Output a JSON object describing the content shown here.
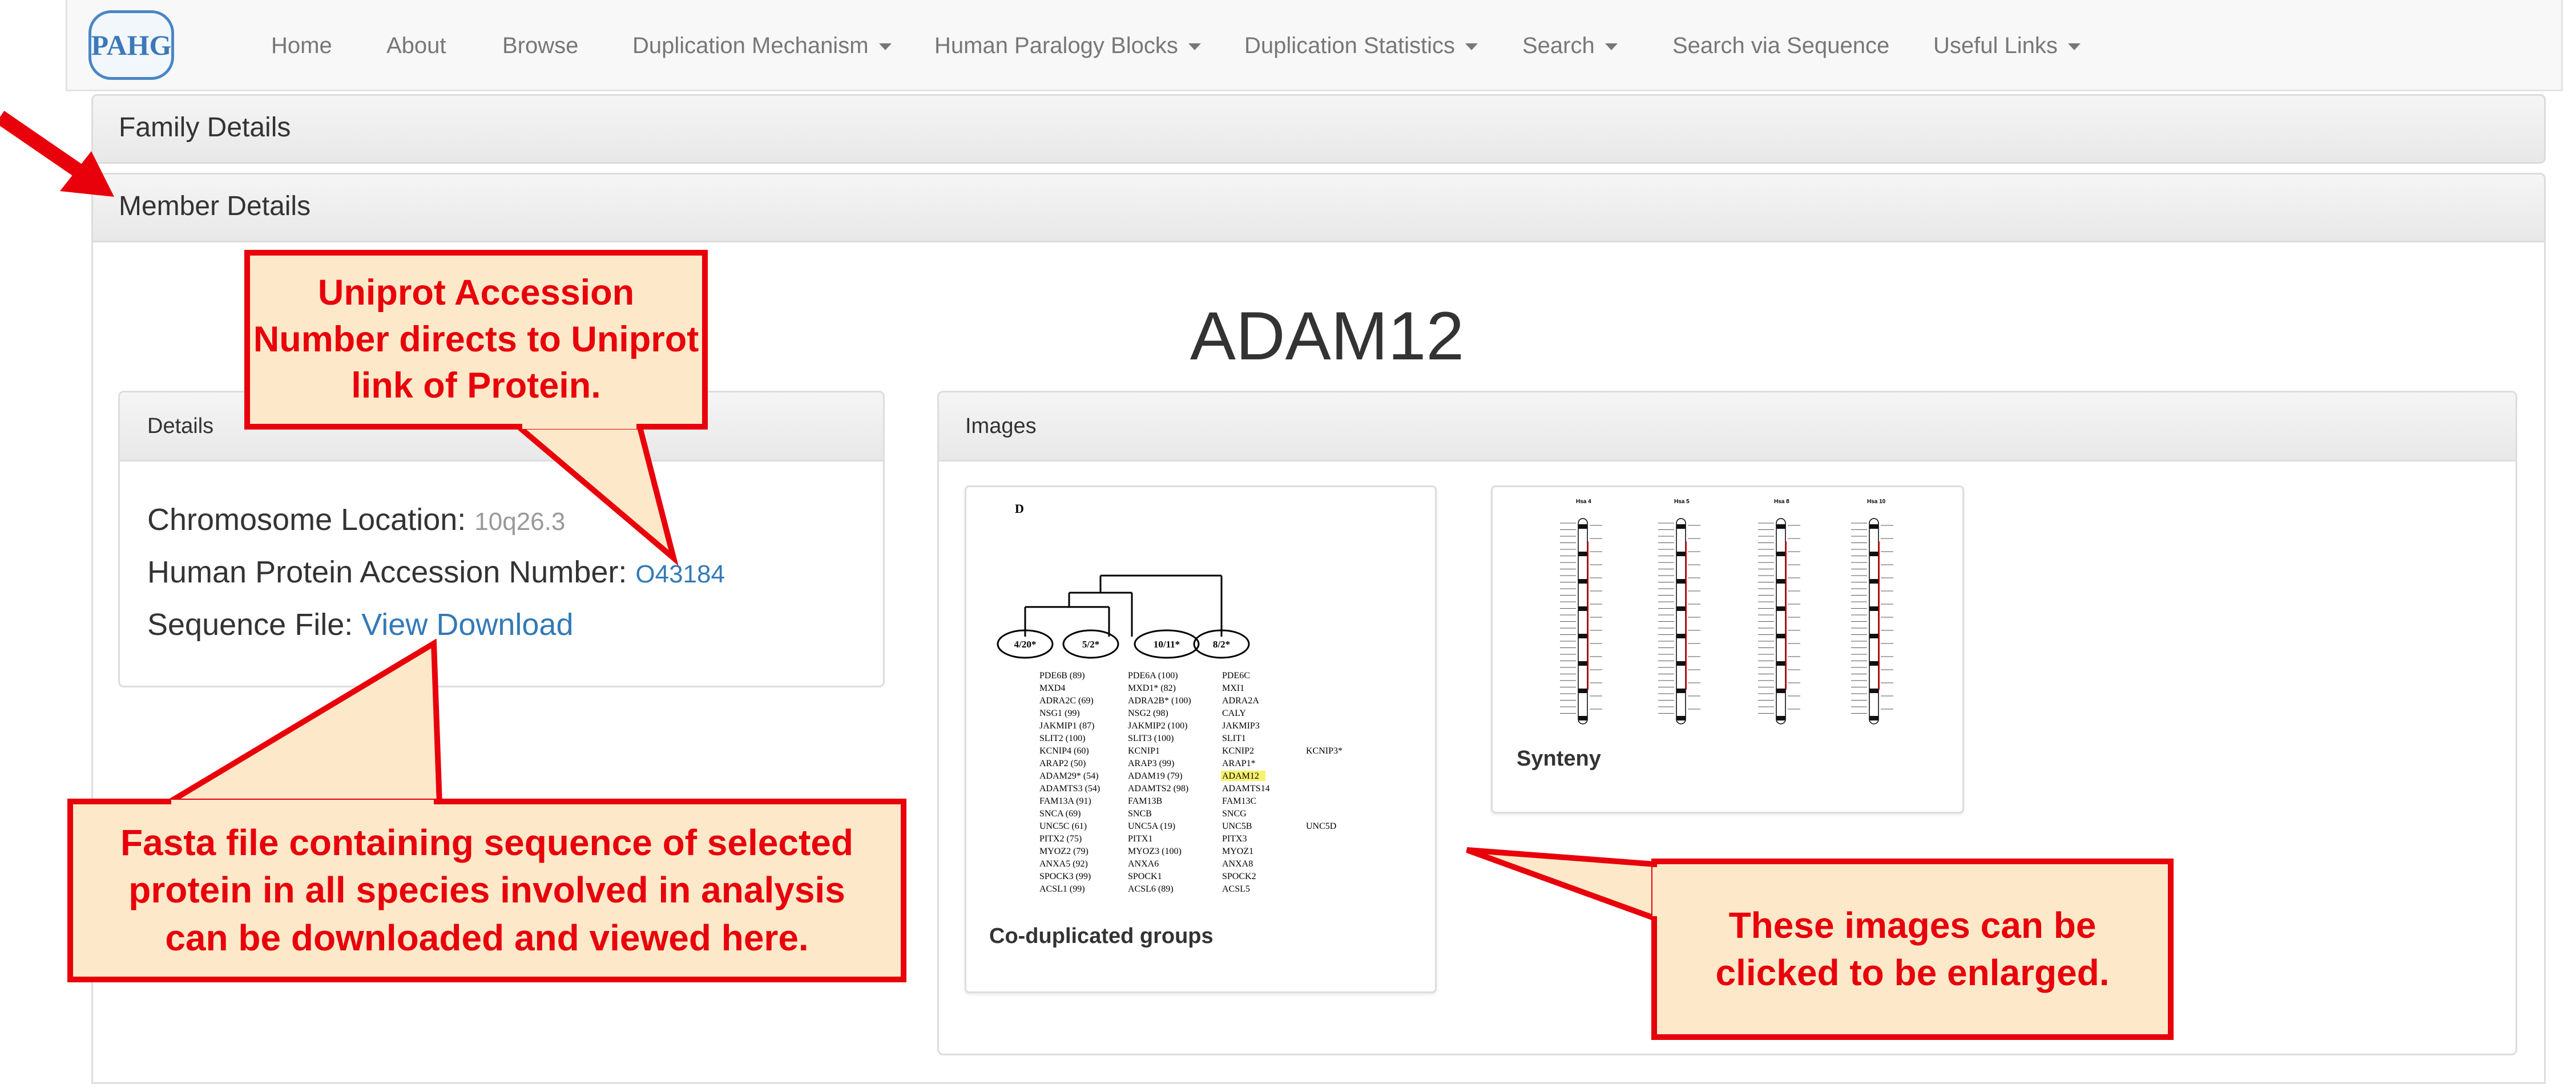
{
  "navbar": {
    "logo_text": "PAHG",
    "items": [
      {
        "label": "Home",
        "dropdown": false
      },
      {
        "label": "About",
        "dropdown": false
      },
      {
        "label": "Browse",
        "dropdown": false
      },
      {
        "label": "Duplication Mechanism",
        "dropdown": true
      },
      {
        "label": "Human Paralogy Blocks",
        "dropdown": true
      },
      {
        "label": "Duplication Statistics",
        "dropdown": true
      },
      {
        "label": "Search",
        "dropdown": true
      },
      {
        "label": "Search via Sequence",
        "dropdown": false
      },
      {
        "label": "Useful Links",
        "dropdown": true
      }
    ]
  },
  "family_panel": {
    "title": "Family Details"
  },
  "member_panel": {
    "title": "Member Details"
  },
  "gene": {
    "name": "ADAM12"
  },
  "details": {
    "title": "Details",
    "chromosome_label": "Chromosome Location:",
    "chromosome_value": "10q26.3",
    "accession_label": "Human Protein Accession Number:",
    "accession_value": "O43184",
    "sequence_label": "Sequence File:",
    "sequence_links": "View Download"
  },
  "images": {
    "title": "Images",
    "items": [
      {
        "caption": "Co-duplicated groups",
        "panel_letter": "D",
        "nodes": [
          "4/20*",
          "5/2*",
          "10/11*",
          "8/2*"
        ],
        "rows": [
          [
            "PDE6B (89)",
            "PDE6A (100)",
            "PDE6C"
          ],
          [
            "MXD4",
            "MXD1* (82)",
            "MXI1"
          ],
          [
            "ADRA2C (69)",
            "ADRA2B* (100)",
            "ADRA2A"
          ],
          [
            "NSG1 (99)",
            "NSG2 (98)",
            "CALY"
          ],
          [
            "JAKMIP1 (87)",
            "JAKMIP2 (100)",
            "JAKMIP3"
          ],
          [
            "SLIT2 (100)",
            "SLIT3 (100)",
            "SLIT1"
          ],
          [
            "KCNIP4 (60)",
            "KCNIP1",
            "KCNIP2",
            "KCNIP3*"
          ],
          [
            "ARAP2 (50)",
            "ARAP3 (99)",
            "ARAP1*"
          ],
          [
            "ADAM29* (54)",
            "ADAM19 (79)",
            "ADAM12"
          ],
          [
            "ADAMTS3 (54)",
            "ADAMTS2 (98)",
            "ADAMTS14"
          ],
          [
            "FAM13A (91)",
            "FAM13B",
            "FAM13C"
          ],
          [
            "SNCA (69)",
            "SNCB",
            "SNCG"
          ],
          [
            "UNC5C (61)",
            "UNC5A (19)",
            "UNC5B",
            "UNC5D"
          ],
          [
            "PITX2 (75)",
            "PITX1",
            "PITX3"
          ],
          [
            "MYOZ2 (79)",
            "MYOZ3 (100)",
            "MYOZ1"
          ],
          [
            "ANXA5 (92)",
            "ANXA6",
            "ANXA8"
          ],
          [
            "SPOCK3 (99)",
            "SPOCK1",
            "SPOCK2"
          ],
          [
            "ACSL1 (99)",
            "ACSL6 (89)",
            "ACSL5"
          ]
        ]
      },
      {
        "caption": "Synteny",
        "chromosome_labels": [
          "Hsa 4",
          "Hsa 5",
          "Hsa 8",
          "Hsa 10"
        ]
      }
    ]
  },
  "annotations": [
    {
      "text": "Uniprot Accession Number directs to Uniprot link of Protein."
    },
    {
      "text": "Fasta file containing sequence of selected protein in all species involved in analysis can be downloaded and viewed here."
    },
    {
      "text": "These images can be clicked to be enlarged."
    }
  ],
  "colors": {
    "annotation_red": "#e8000b",
    "annotation_fill": "#fde9c9",
    "link_blue": "#337ab7",
    "highlight": "#f7f26b"
  }
}
